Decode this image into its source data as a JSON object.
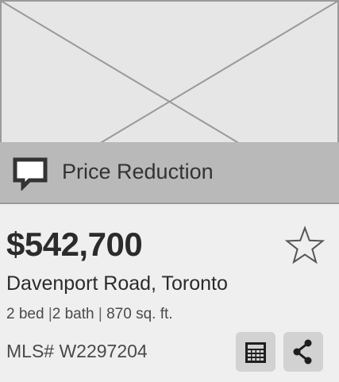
{
  "listing": {
    "banner": {
      "label": "Price Reduction",
      "icon": "speech-bubble-icon"
    },
    "price": "$542,700",
    "address": "Davenport Road, Toronto",
    "specs": {
      "beds": "2 bed",
      "baths": "2 bath",
      "area": "870 sq. ft.",
      "separator": "|"
    },
    "mls": "MLS# W2297204",
    "actions": {
      "favorite_icon": "star-outline-icon",
      "calculator_icon": "calculator-icon",
      "share_icon": "share-icon"
    }
  },
  "colors": {
    "card_background": "#efefef",
    "placeholder_fill": "#e6e6e6",
    "placeholder_stroke": "#9a9a9a",
    "banner_background": "#b9b9b9",
    "text_dark": "#2b2b2b",
    "text_muted": "#4a4a4a",
    "button_background": "#d2d2d2"
  }
}
